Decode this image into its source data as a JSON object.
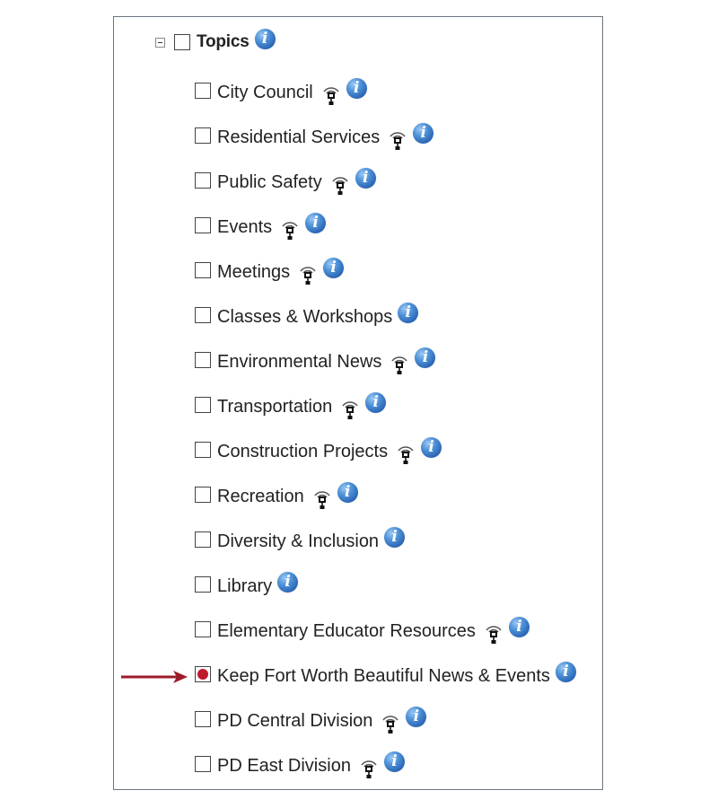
{
  "tree": {
    "root": {
      "label": "Topics",
      "expanded": true,
      "checked": false,
      "toggle_icon": "collapse-minus-icon",
      "info_icon": "info-icon"
    },
    "items": [
      {
        "label": "City Council",
        "checked": false,
        "rss": true
      },
      {
        "label": "Residential Services",
        "checked": false,
        "rss": true
      },
      {
        "label": "Public Safety",
        "checked": false,
        "rss": true
      },
      {
        "label": "Events",
        "checked": false,
        "rss": true
      },
      {
        "label": "Meetings",
        "checked": false,
        "rss": true
      },
      {
        "label": "Classes & Workshops",
        "checked": false,
        "rss": false
      },
      {
        "label": "Environmental News",
        "checked": false,
        "rss": true
      },
      {
        "label": "Transportation",
        "checked": false,
        "rss": true
      },
      {
        "label": "Construction Projects",
        "checked": false,
        "rss": true
      },
      {
        "label": "Recreation",
        "checked": false,
        "rss": true
      },
      {
        "label": "Diversity & Inclusion",
        "checked": false,
        "rss": false
      },
      {
        "label": "Library",
        "checked": false,
        "rss": false
      },
      {
        "label": "Elementary Educator Resources",
        "checked": false,
        "rss": true
      },
      {
        "label": "Keep Fort Worth Beautiful News & Events",
        "checked": true,
        "rss": false,
        "highlighted": true
      },
      {
        "label": "PD Central Division",
        "checked": false,
        "rss": true
      },
      {
        "label": "PD East Division",
        "checked": false,
        "rss": true
      }
    ]
  },
  "icons": {
    "rss": "broadcast-feed-icon",
    "info": "info-icon",
    "pointer": "red-arrow-pointer"
  },
  "colors": {
    "text": "#222222",
    "border": "#6b7580",
    "checked_dot": "#c0192e",
    "arrow": "#9b1b2a",
    "info_blue": "#2a64b3"
  }
}
